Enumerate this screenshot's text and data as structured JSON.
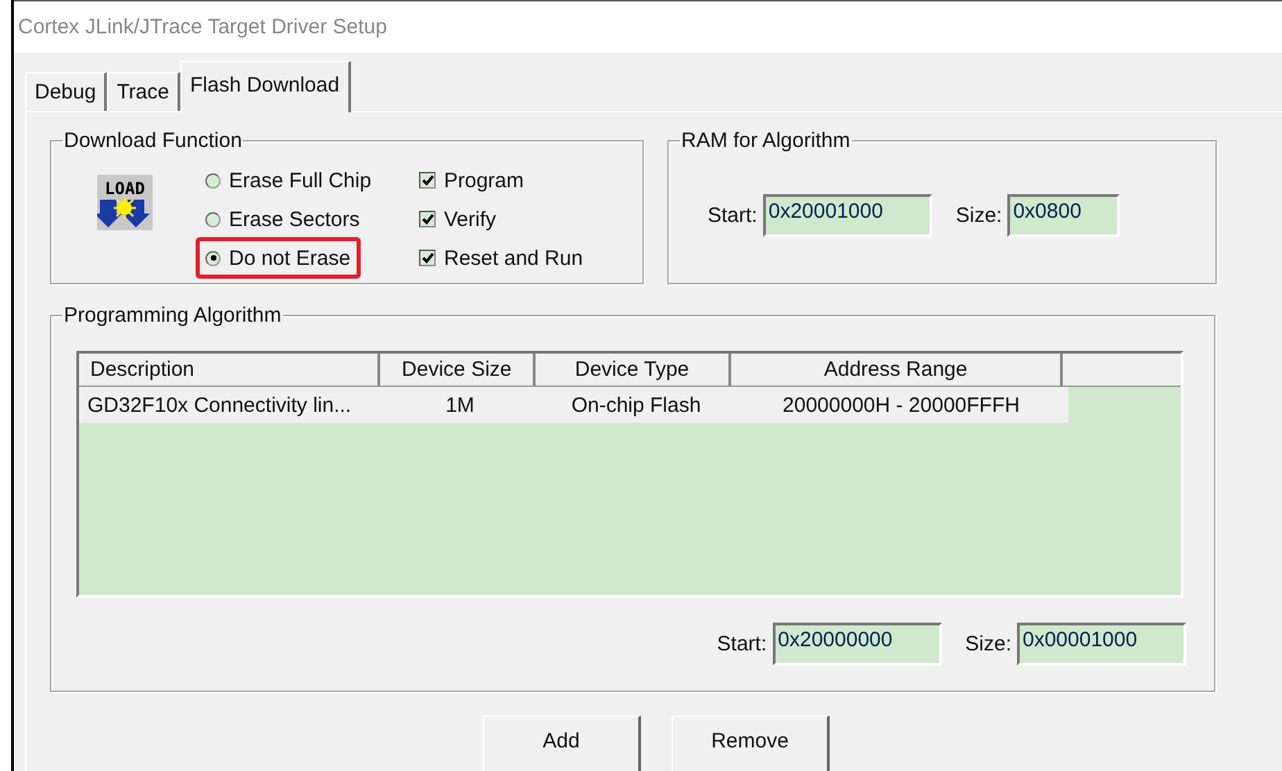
{
  "window": {
    "title": "Cortex JLink/JTrace Target Driver Setup"
  },
  "tabs": [
    {
      "label": "Debug",
      "selected": false
    },
    {
      "label": "Trace",
      "selected": false
    },
    {
      "label": "Flash Download",
      "selected": true
    }
  ],
  "download_function": {
    "title": "Download Function",
    "icon_label": "LOAD",
    "erase_options": [
      {
        "label": "Erase Full Chip",
        "selected": false,
        "highlighted": false
      },
      {
        "label": "Erase Sectors",
        "selected": false,
        "highlighted": false
      },
      {
        "label": "Do not Erase",
        "selected": true,
        "highlighted": true
      }
    ],
    "options": [
      {
        "label": "Program",
        "checked": true
      },
      {
        "label": "Verify",
        "checked": true
      },
      {
        "label": "Reset and Run",
        "checked": true
      }
    ]
  },
  "ram_for_algorithm": {
    "title": "RAM for Algorithm",
    "start_label": "Start:",
    "start": "0x20001000",
    "size_label": "Size:",
    "size": "0x0800"
  },
  "programming_algorithm": {
    "title": "Programming Algorithm",
    "columns": [
      "Description",
      "Device Size",
      "Device Type",
      "Address Range"
    ],
    "rows": [
      {
        "cells": [
          "GD32F10x Connectivity lin...",
          "1M",
          "On-chip Flash",
          "20000000H - 20000FFFH"
        ]
      }
    ],
    "start_label": "Start:",
    "start": "0x20000000",
    "size_label": "Size:",
    "size": "0x00001000"
  },
  "buttons": [
    "Add",
    "Remove"
  ]
}
